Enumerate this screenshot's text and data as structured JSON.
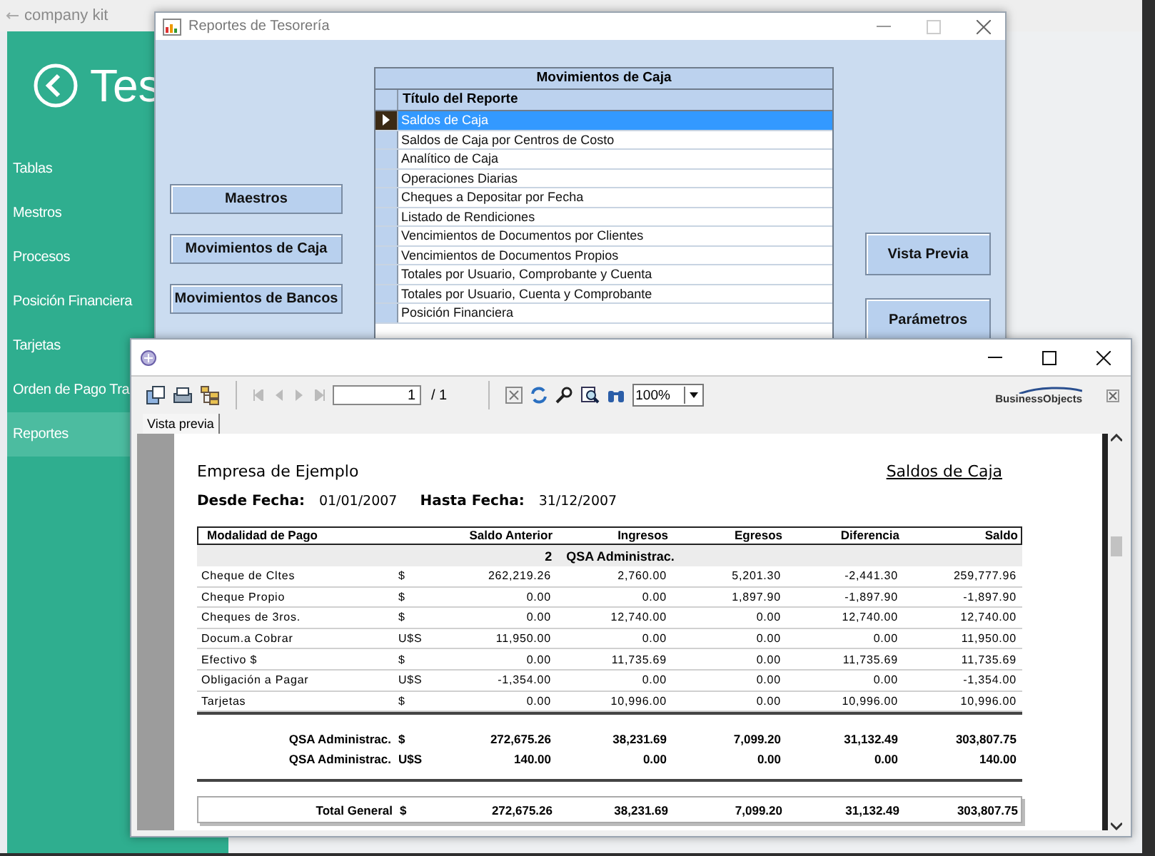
{
  "app": {
    "title": "company kit",
    "heading": "Tes",
    "sidebar": [
      {
        "label": "Tablas",
        "selected": false
      },
      {
        "label": "Mestros",
        "selected": false
      },
      {
        "label": "Procesos",
        "selected": false
      },
      {
        "label": "Posición Financiera",
        "selected": false
      },
      {
        "label": "Tarjetas",
        "selected": false
      },
      {
        "label": "Orden de Pago Tra",
        "selected": false
      },
      {
        "label": "Reportes",
        "selected": true
      }
    ]
  },
  "dialog": {
    "title": "Reportes de Tesorería",
    "left_buttons": [
      "Maestros",
      "Movimientos de Caja",
      "Movimientos de Bancos"
    ],
    "grid": {
      "title": "Movimientos de Caja",
      "column": "Título del Reporte",
      "rows": [
        {
          "label": "Saldos de Caja",
          "selected": true
        },
        {
          "label": "Saldos de Caja por Centros de Costo",
          "selected": false
        },
        {
          "label": "Analítico de Caja",
          "selected": false
        },
        {
          "label": "Operaciones Diarias",
          "selected": false
        },
        {
          "label": "Cheques a Depositar por Fecha",
          "selected": false
        },
        {
          "label": "Listado de Rendiciones",
          "selected": false
        },
        {
          "label": "Vencimientos de Documentos por Clientes",
          "selected": false
        },
        {
          "label": "Vencimientos de Documentos Propios",
          "selected": false
        },
        {
          "label": "Totales por Usuario, Comprobante y Cuenta",
          "selected": false
        },
        {
          "label": "Totales por Usuario, Cuenta y Comprobante",
          "selected": false
        },
        {
          "label": "Posición Financiera",
          "selected": false
        }
      ]
    },
    "right_buttons": [
      "Vista Previa",
      "Parámetros"
    ]
  },
  "preview": {
    "toolbar": {
      "page": "1",
      "page_count": "/ 1",
      "zoom": "100%",
      "brand": "BusinessObjects"
    },
    "tab": "Vista previa",
    "report": {
      "company": "Empresa de Ejemplo",
      "title": "Saldos de Caja",
      "from_label": "Desde Fecha:",
      "from": "01/01/2007",
      "to_label": "Hasta Fecha:",
      "to": "31/12/2007",
      "columns": [
        "Modalidad de Pago",
        "Saldo Anterior",
        "Ingresos",
        "Egresos",
        "Diferencia",
        "Saldo"
      ],
      "group": {
        "number": "2",
        "name": "QSA Administrac."
      },
      "rows": [
        {
          "name": "Cheque de Cltes",
          "currency": "$",
          "values": [
            "262,219.26",
            "2,760.00",
            "5,201.30",
            "-2,441.30",
            "259,777.96"
          ]
        },
        {
          "name": "Cheque Propio",
          "currency": "$",
          "values": [
            "0.00",
            "0.00",
            "1,897.90",
            "-1,897.90",
            "-1,897.90"
          ]
        },
        {
          "name": "Cheques de 3ros.",
          "currency": "$",
          "values": [
            "0.00",
            "12,740.00",
            "0.00",
            "12,740.00",
            "12,740.00"
          ]
        },
        {
          "name": "Docum.a Cobrar",
          "currency": "U$S",
          "values": [
            "11,950.00",
            "0.00",
            "0.00",
            "0.00",
            "11,950.00"
          ]
        },
        {
          "name": "Efectivo $",
          "currency": "$",
          "values": [
            "0.00",
            "11,735.69",
            "0.00",
            "11,735.69",
            "11,735.69"
          ]
        },
        {
          "name": "Obligación a Pagar",
          "currency": "U$S",
          "values": [
            "-1,354.00",
            "0.00",
            "0.00",
            "0.00",
            "-1,354.00"
          ]
        },
        {
          "name": "Tarjetas",
          "currency": "$",
          "values": [
            "0.00",
            "10,996.00",
            "0.00",
            "10,996.00",
            "10,996.00"
          ]
        }
      ],
      "subtotals": [
        {
          "label": "QSA Administrac.",
          "currency": "$",
          "values": [
            "272,675.26",
            "38,231.69",
            "7,099.20",
            "31,132.49",
            "303,807.75"
          ]
        },
        {
          "label": "QSA Administrac.",
          "currency": "U$S",
          "values": [
            "140.00",
            "0.00",
            "0.00",
            "0.00",
            "140.00"
          ]
        }
      ],
      "total": {
        "label": "Total General",
        "currency": "$",
        "values": [
          "272,675.26",
          "38,231.69",
          "7,099.20",
          "31,132.49",
          "303,807.75"
        ]
      }
    }
  }
}
